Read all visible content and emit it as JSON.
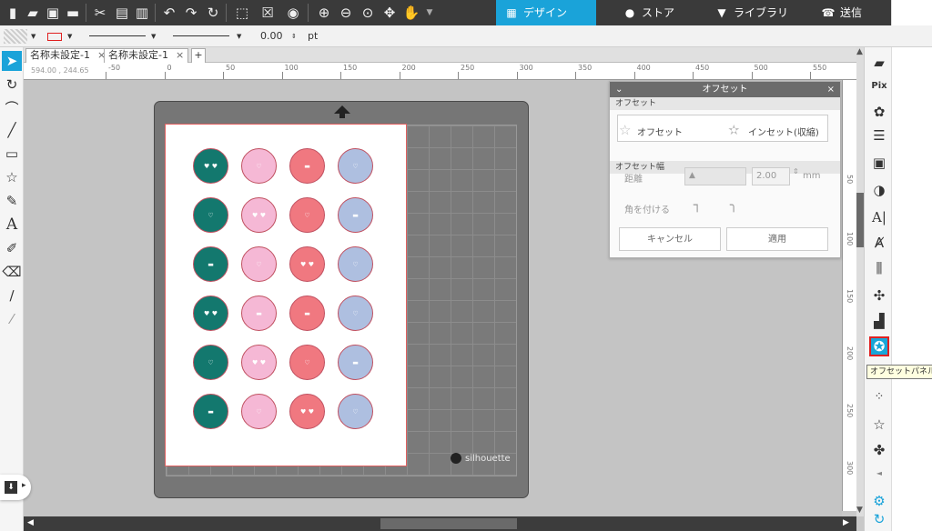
{
  "nav_tabs": [
    {
      "label": "デザイン",
      "icon": "grid-icon",
      "active": true
    },
    {
      "label": "ストア",
      "icon": "store-icon",
      "active": false
    },
    {
      "label": "ライブラリ",
      "icon": "library-icon",
      "active": false
    },
    {
      "label": "送信",
      "icon": "send-icon",
      "active": false
    }
  ],
  "subbar": {
    "line_width_value": "0.00",
    "line_width_unit": "pt"
  },
  "doc_tabs": [
    {
      "label": "名称未設定-1"
    },
    {
      "label": "名称未設定-1"
    }
  ],
  "ruler": {
    "coords": "594.00 , 244.65",
    "numbers": [
      "-50",
      "0",
      "50",
      "100",
      "150",
      "200",
      "250",
      "300",
      "350",
      "400",
      "450",
      "500",
      "550"
    ],
    "vnumbers": [
      "50",
      "100",
      "150",
      "200",
      "250",
      "300"
    ]
  },
  "mat": {
    "brand": "silhouette"
  },
  "circles": [
    [
      "teal-hearts",
      "pink-thankyou",
      "salmon-special",
      "blue-love"
    ],
    [
      "teal-love",
      "pink-hearts",
      "salmon-thankyou",
      "blue-special"
    ],
    [
      "teal-special",
      "pink-love",
      "salmon-hearts",
      "blue-thankyou"
    ],
    [
      "teal-hearts",
      "pink-special",
      "salmon-special",
      "blue-love"
    ],
    [
      "teal-love",
      "pink-hearts",
      "salmon-thankyou",
      "blue-special"
    ],
    [
      "teal-special",
      "pink-love",
      "salmon-hearts",
      "blue-thankyou"
    ]
  ],
  "offset_panel": {
    "title": "オフセット",
    "section_offset": "オフセット",
    "offset_label": "オフセット",
    "inset_label": "インセット(収縮)",
    "section_width": "オフセット幅",
    "distance_label": "距離",
    "distance_value": "2.00",
    "distance_unit": "mm",
    "corner_label": "角を付ける",
    "cancel_label": "キャンセル",
    "apply_label": "適用"
  },
  "tooltip": "オフセットパネル",
  "colors": {
    "accent": "#1aa3d9",
    "toolbar": "#3a3a3a",
    "highlight_border": "#e02020"
  }
}
